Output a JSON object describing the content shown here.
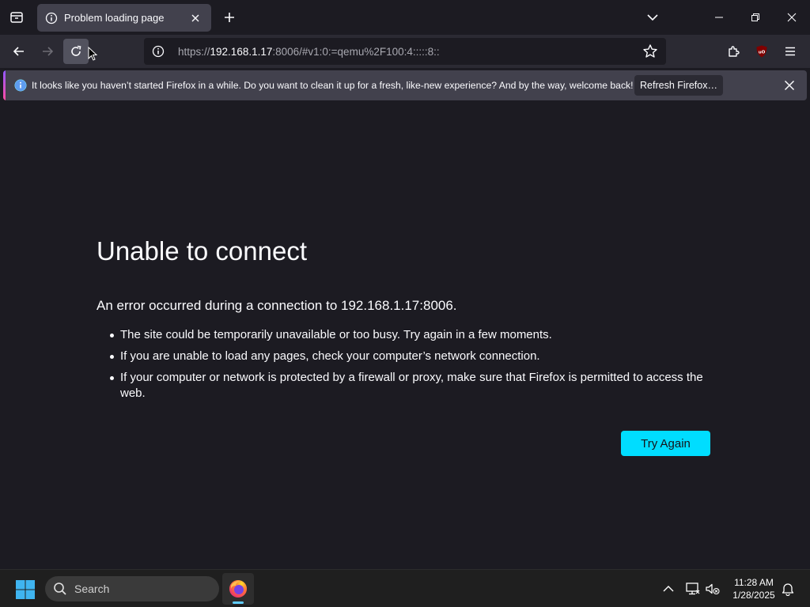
{
  "tab": {
    "title": "Problem loading page"
  },
  "urlbar": {
    "scheme": "https://",
    "host": "192.168.1.17",
    "rest": ":8006/#v1:0:=qemu%2F100:4:::::8::"
  },
  "notification": {
    "message": "It looks like you haven’t started Firefox in a while. Do you want to clean it up for a fresh, like-new experience? And by the way, welcome back!",
    "button_label": "Refresh Firefox…"
  },
  "error": {
    "title": "Unable to connect",
    "description": "An error occurred during a connection to 192.168.1.17:8006.",
    "items": [
      "The site could be temporarily unavailable or too busy. Try again in a few moments.",
      "If you are unable to load any pages, check your computer’s network connection.",
      "If your computer or network is protected by a firewall or proxy, make sure that Firefox is permitted to access the web."
    ],
    "button_label": "Try Again"
  },
  "taskbar": {
    "search_label": "Search",
    "time": "11:28 AM",
    "date": "1/28/2025"
  },
  "colors": {
    "accent": "#00ddff",
    "background": "#1c1b22",
    "toolbar": "#2b2a33"
  }
}
